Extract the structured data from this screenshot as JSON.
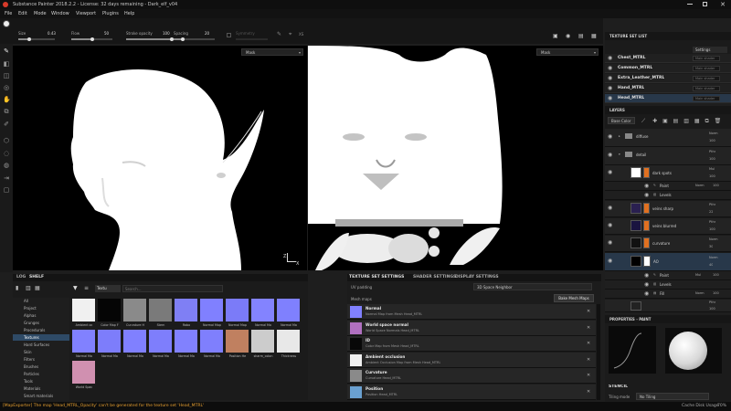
{
  "window": {
    "title": "Substance Painter 2018.2.2 - License: 32 days remaining - Dark_elf_v04"
  },
  "menu": [
    "File",
    "Edit",
    "Mode",
    "Window",
    "Viewport",
    "Plugins",
    "Help"
  ],
  "toolbar": {
    "size_label": "Size",
    "size_value": "0.43",
    "flow_label": "Flow",
    "flow_value": "50",
    "stroke_label": "Stroke opacity",
    "stroke_value": "100",
    "spacing_label": "Spacing",
    "spacing_value": "20",
    "symmetry_label": "Symmetry"
  },
  "viewport": {
    "left_mode": "Mask",
    "right_mode": "Mask",
    "axis_z": "Z",
    "axis_x": "X"
  },
  "texture_set_list": {
    "header": "TEXTURE SET LIST",
    "settings_label": "Settings",
    "items": [
      {
        "name": "Chest_MTRL",
        "shader": "Main shader"
      },
      {
        "name": "Common_MTRL",
        "shader": "Main shader"
      },
      {
        "name": "Extra_Leather_MTRL",
        "shader": "Main shader"
      },
      {
        "name": "Hand_MTRL",
        "shader": "Main shader"
      },
      {
        "name": "Head_MTRL",
        "shader": "Main shader"
      }
    ]
  },
  "layers": {
    "header": "LAYERS",
    "channel": "Base Color",
    "items": [
      {
        "name": "diffuse",
        "blend": "Norm",
        "opacity": "100",
        "kind": "folder"
      },
      {
        "name": "detail",
        "blend": "Pthr",
        "opacity": "100",
        "kind": "folder"
      },
      {
        "name": "dark spots",
        "blend": "Mul",
        "opacity": "100",
        "kind": "fill"
      },
      {
        "name": "Paint",
        "blend": "Norm",
        "opacity": "100",
        "kind": "effect"
      },
      {
        "name": "Levels",
        "blend": "",
        "opacity": "",
        "kind": "effect"
      },
      {
        "name": "veins sharp",
        "blend": "Pthr",
        "opacity": "22",
        "kind": "veins"
      },
      {
        "name": "veins blurred",
        "blend": "Pthr",
        "opacity": "100",
        "kind": "veins"
      },
      {
        "name": "curvature",
        "blend": "Norm",
        "opacity": "30",
        "kind": "fill"
      },
      {
        "name": "AO",
        "blend": "Norm",
        "opacity": "40",
        "kind": "ao"
      },
      {
        "name": "Paint",
        "blend": "Mul",
        "opacity": "100",
        "kind": "effect"
      },
      {
        "name": "Levels",
        "blend": "",
        "opacity": "",
        "kind": "effect"
      },
      {
        "name": "Fill",
        "blend": "Norm",
        "opacity": "100",
        "kind": "effect"
      },
      {
        "name": "",
        "blend": "Pthr",
        "opacity": "100",
        "kind": "fill"
      }
    ]
  },
  "properties": {
    "header": "PROPERTIES - PAINT",
    "stencil_header": "STENCIL",
    "tiling_label": "Tiling mode",
    "tiling_value": "No Tiling"
  },
  "shelf": {
    "tabs": [
      "LOG",
      "SHELF"
    ],
    "search_placeholder": "Search...",
    "filter_tag": "Textu",
    "categories": [
      "All",
      "Project",
      "Alphas",
      "Grunges",
      "Procedurals",
      "Textures",
      "Hard Surfaces",
      "Skin",
      "Filters",
      "Brushes",
      "Particles",
      "Tools",
      "Materials",
      "Smart materials"
    ],
    "selected_category": "Textures",
    "resources": [
      {
        "label": "Ambient oc",
        "color": "#f0f0f0"
      },
      {
        "label": "Color Map F",
        "color": "#050505"
      },
      {
        "label": "Curvature H",
        "color": "#8a8a8a"
      },
      {
        "label": "Stern",
        "color": "#7a7a7a"
      },
      {
        "label": "Rabo",
        "color": "#7f7ff4"
      },
      {
        "label": "Normal Map",
        "color": "#8080ff"
      },
      {
        "label": "Normal Map",
        "color": "#7b7bf8"
      },
      {
        "label": "Normal Ma",
        "color": "#8383ff"
      },
      {
        "label": "Normal Ma",
        "color": "#7f80fe"
      },
      {
        "label": "Normal Ma",
        "color": "#8181ff"
      },
      {
        "label": "Normal Ma",
        "color": "#7d7dfb"
      },
      {
        "label": "Normal Ma",
        "color": "#8080ff"
      },
      {
        "label": "Normal Ma",
        "color": "#7e7efc"
      },
      {
        "label": "Normal Ma",
        "color": "#8181fe"
      },
      {
        "label": "Normal Ma",
        "color": "#7f7ffd"
      },
      {
        "label": "Position He",
        "color": "#c08060"
      },
      {
        "label": "sharm_colon",
        "color": "#cccccc"
      },
      {
        "label": "Thickness",
        "color": "#e8e8e8"
      },
      {
        "label": "World Spac",
        "color": "#d090b0"
      }
    ]
  },
  "bake": {
    "tabs": [
      "TEXTURE SET SETTINGS",
      "SHADER SETTINGS",
      "DISPLAY SETTINGS"
    ],
    "uv_padding_label": "UV padding",
    "uv_padding_value": "3D Space Neighbor",
    "mesh_maps_label": "Mesh maps",
    "bake_button": "Bake Mesh Maps",
    "maps": [
      {
        "title": "Normal",
        "sub": "Normal Map from Mesh Head_MTRL",
        "color": "#8080ff"
      },
      {
        "title": "World space normal",
        "sub": "World Space Normals Head_MTRL",
        "color": "#b070c0"
      },
      {
        "title": "ID",
        "sub": "Color Map from Mesh Head_MTRL",
        "color": "#080808"
      },
      {
        "title": "Ambient occlusion",
        "sub": "Ambient Occlusion Map from Mesh Head_MTRL",
        "color": "#f0f0f0"
      },
      {
        "title": "Curvature",
        "sub": "Curvature Head_MTRL",
        "color": "#8a8a8a"
      },
      {
        "title": "Position",
        "sub": "Position Head_MTRL",
        "color": "#6aa0d0"
      }
    ]
  },
  "status": {
    "message": "[MapExporter] The map 'Head_MTRL_Opacity' can't be generated for the texture set 'Head_MTRL'",
    "cache": "Cache Disk Usage",
    "cache_value": "70%"
  }
}
